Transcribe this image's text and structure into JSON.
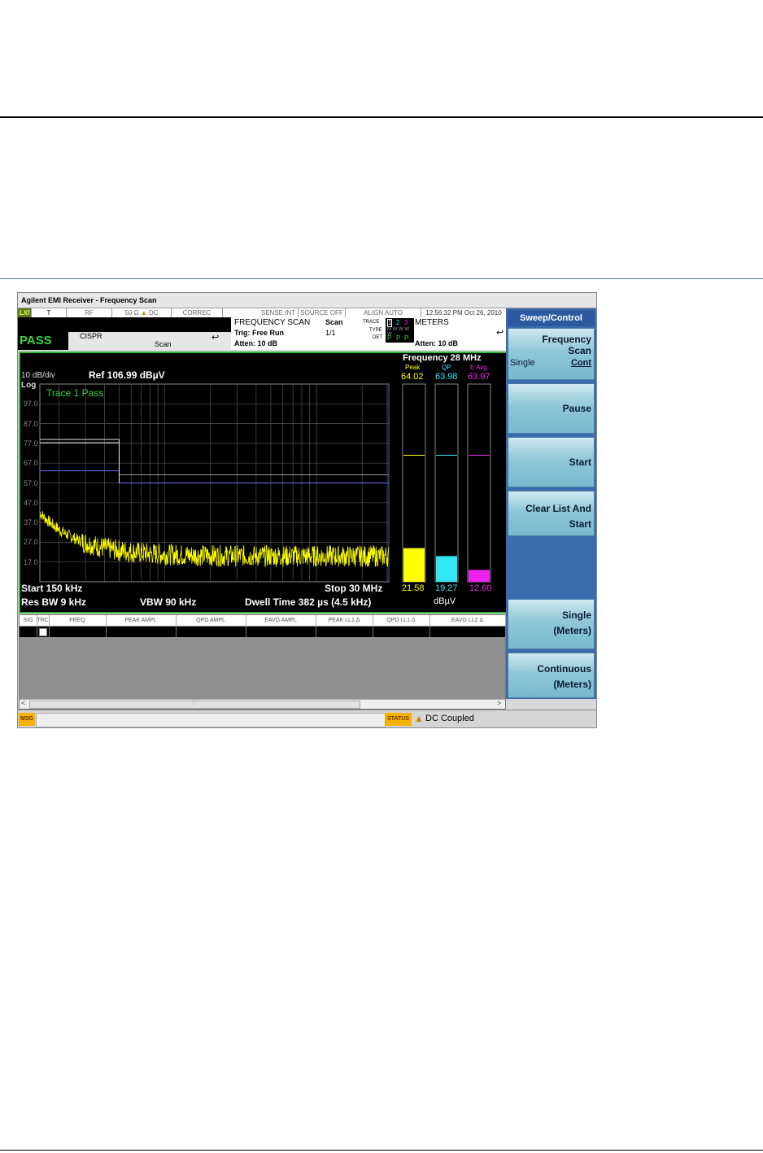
{
  "window": {
    "title": "Agilent EMI Receiver   - Frequency Scan"
  },
  "status_row": {
    "mode_icon": "LXI",
    "t": "T",
    "rf": "RF",
    "impedance": "50 Ω",
    "dc": "DC",
    "correc": "CORREC",
    "sense": "SENSE:INT",
    "source": "SOURCE OFF",
    "align": "ALIGN AUTO",
    "datetime": "12:56:32 PM Oct 26, 2010"
  },
  "header": {
    "pass_label": "PASS",
    "cispr": "CISPR",
    "scan": "Scan",
    "freq_scan": "FREQUENCY SCAN",
    "trig": "Trig: Free Run",
    "atten_left": "Atten: 10 dB",
    "scan_label": "Scan",
    "scan_count": "1/1",
    "trace_label": "TRACE",
    "trace_nums": [
      "1",
      "2",
      "3"
    ],
    "type_label": "TYPE",
    "type_val": "M W W W W",
    "det_label": "DET",
    "det_vals": [
      "P",
      "P",
      "P"
    ],
    "meters": "METERS",
    "atten_right": "Atten: 10 dB"
  },
  "plot": {
    "scale": "10 dB/div",
    "log": "Log",
    "ref": "Ref 106.99 dBµV",
    "trace_status": "Trace 1 Pass",
    "y_ticks": [
      "97.0",
      "87.0",
      "77.0",
      "67.0",
      "57.0",
      "47.0",
      "37.0",
      "27.0",
      "17.0"
    ],
    "start": "Start 150 kHz",
    "stop": "Stop 30 MHz",
    "res_bw": "Res BW 9 kHz",
    "vbw": "VBW 90 kHz",
    "dwell": "Dwell Time 382 µs (4.5 kHz)",
    "limit_upper_dbuv": 79.0,
    "limit_lower_dbuv": 66.0
  },
  "meters": {
    "frequency": "Frequency  28 MHz",
    "labels": [
      "Peak",
      "QP",
      "E Avg"
    ],
    "values": [
      "64.02",
      "63.98",
      "63.97"
    ],
    "bottom_values": [
      "21.58",
      "19.27",
      "12.60"
    ],
    "unit": "dBµV",
    "colors": [
      "#ffff00",
      "#33e6f2",
      "#ee22ee"
    ],
    "fill_fractions": [
      0.17,
      0.13,
      0.06
    ],
    "marker_fractions": [
      0.64,
      0.64,
      0.64
    ]
  },
  "table": {
    "headers": [
      "SIG",
      "TRC",
      "FREQ",
      "PEAK AMPL",
      "QPD AMPL",
      "EAVG AMPL",
      "PEAK LL1 Δ",
      "QPD LL1 Δ",
      "EAVG LL2 Δ"
    ]
  },
  "softkeys": {
    "header": "Sweep/Control",
    "frequency_scan": {
      "line1": "Frequency",
      "line2": "Scan",
      "opt1": "Single",
      "opt2": "Cont"
    },
    "pause": "Pause",
    "start": "Start",
    "clear_line1": "Clear List And",
    "clear_line2": "Start",
    "single_line1": "Single",
    "single_line2": "(Meters)",
    "continuous_line1": "Continuous",
    "continuous_line2": "(Meters)"
  },
  "bottom": {
    "msg": "MSG",
    "status": "STATUS",
    "status_text": "DC Coupled"
  },
  "colors": {
    "pass": "#3bd13b",
    "trace": "#ffff00",
    "frame": "#3bb53b",
    "softkey_bg": "#3b6cb0"
  }
}
